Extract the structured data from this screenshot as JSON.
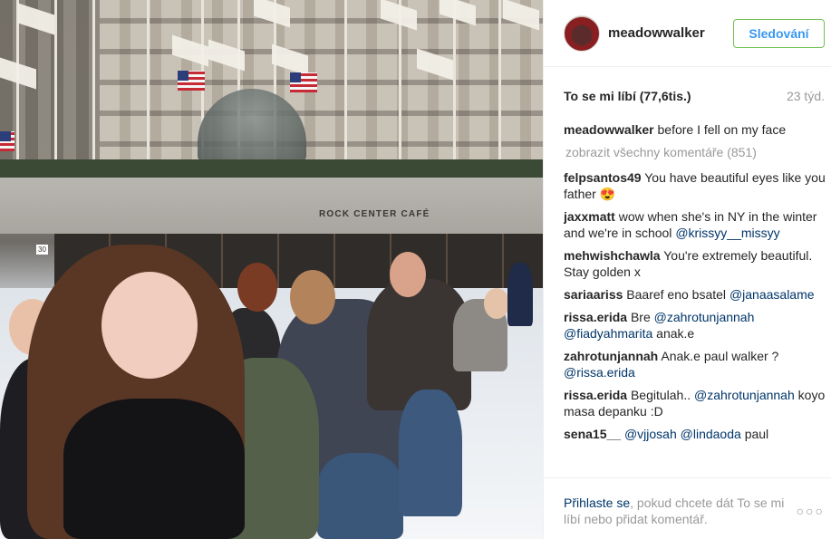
{
  "post": {
    "username": "meadowwalker",
    "follow_label": "Sledování",
    "likes": "To se mi líbí (77,6tis.)",
    "age": "23 týd."
  },
  "photo": {
    "sign_text": "ROCK CENTER CAFÉ",
    "address_number": "30"
  },
  "caption": {
    "user": "meadowwalker",
    "text": "before I fell on my face"
  },
  "view_all_label": "zobrazit všechny komentáře (851)",
  "comments": [
    {
      "user": "felpsantos49",
      "text": "You have beautiful eyes like you father 😍"
    },
    {
      "user": "jaxxmatt",
      "text": "wow when she's in NY in the winter and we're in school",
      "mention": "@krissyy__missyy"
    },
    {
      "user": "mehwishchawla",
      "text": "You're extremely beautiful. Stay golden x"
    },
    {
      "user": "sariaariss",
      "text": "Baaref eno bsatel",
      "mention": "@janaasalame"
    },
    {
      "user": "rissa.erida",
      "text": "Bre",
      "mention": "@zahrotunjannah",
      "mention2": "@fiadyahmarita",
      "text2": "anak.e"
    },
    {
      "user": "zahrotunjannah",
      "text": "Anak.e paul walker ?",
      "mention": "@rissa.erida"
    },
    {
      "user": "rissa.erida",
      "text": "Begitulah..",
      "mention": "@zahrotunjannah",
      "text2": "koyo masa depanku :D"
    },
    {
      "user": "sena15__",
      "mention": "@vjjosah",
      "mention2": "@lindaoda",
      "text": "paul"
    }
  ],
  "footer": {
    "login_link": "Přihlaste se",
    "login_text": ", pokud chcete dát To se mi líbí nebo přidat komentář.",
    "more_icon": "more-dots-icon"
  }
}
